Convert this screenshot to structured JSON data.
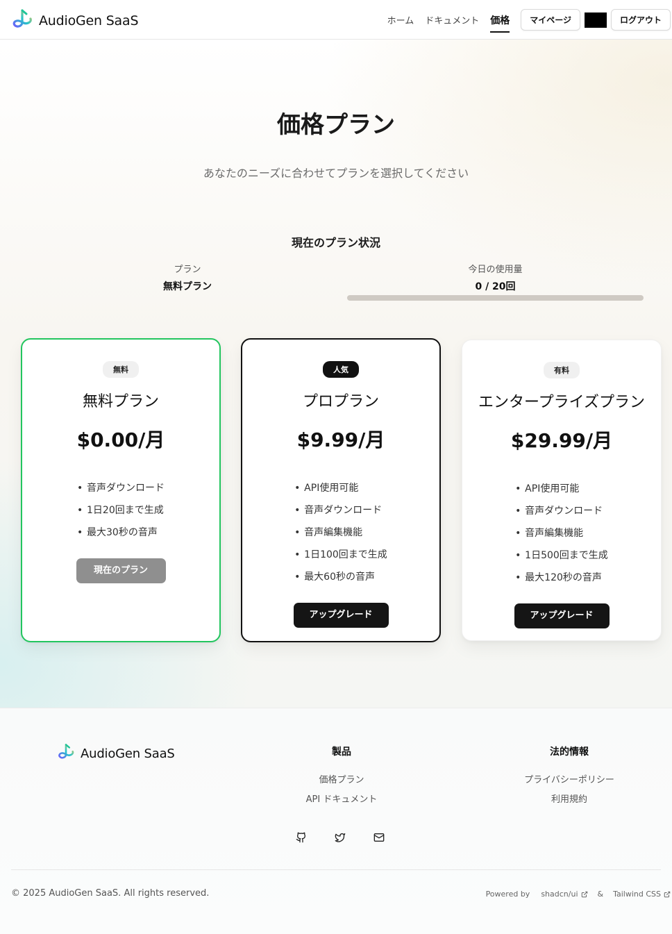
{
  "header": {
    "brand": "AudioGen SaaS",
    "nav": [
      "ホーム",
      "ドキュメント",
      "価格"
    ],
    "active_nav": "価格",
    "mypage": "マイページ",
    "logout": "ログアウト"
  },
  "hero": {
    "title": "価格プラン",
    "subtitle": "あなたのニーズに合わせてプランを選択してください"
  },
  "status": {
    "title": "現在のプラン状況",
    "plan_label": "プラン",
    "plan_value": "無料プラン",
    "usage_label": "今日の使用量",
    "usage_value": "0 / 20回",
    "usage_fraction": 0
  },
  "plans": [
    {
      "badge": "無料",
      "name": "無料プラン",
      "price": "$0.00/月",
      "features": [
        "音声ダウンロード",
        "1日20回まで生成",
        "最大30秒の音声"
      ],
      "button": "現在のプラン"
    },
    {
      "badge": "人気",
      "name": "プロプラン",
      "price": "$9.99/月",
      "features": [
        "API使用可能",
        "音声ダウンロード",
        "音声編集機能",
        "1日100回まで生成",
        "最大60秒の音声"
      ],
      "button": "アップグレード"
    },
    {
      "badge": "有料",
      "name": "エンタープライズプラン",
      "price": "$29.99/月",
      "features": [
        "API使用可能",
        "音声ダウンロード",
        "音声編集機能",
        "1日500回まで生成",
        "最大120秒の音声"
      ],
      "button": "アップグレード"
    }
  ],
  "footer": {
    "brand": "AudioGen SaaS",
    "products_title": "製品",
    "products_links": [
      "価格プラン",
      "API ドキュメント"
    ],
    "legal_title": "法的情報",
    "legal_links": [
      "プライバシーポリシー",
      "利用規約"
    ],
    "social_icons": [
      "github-icon",
      "twitter-icon",
      "mail-icon"
    ],
    "copyright": "© 2025 AudioGen SaaS. All rights reserved.",
    "powered_by": "Powered by",
    "shadcn": "shadcn/ui",
    "amp": "&",
    "tailwind": "Tailwind CSS"
  },
  "colors": {
    "free_border": "#22c55e",
    "pro_border": "#111111",
    "primary_button": "#151515",
    "disabled_button": "#8f8f8f"
  }
}
